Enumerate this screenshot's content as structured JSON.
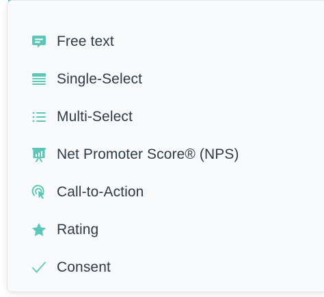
{
  "theme": {
    "accent": "#5cc6b9",
    "text": "#2e3a48",
    "panel_bg": "#f9fafb"
  },
  "menu": {
    "items": [
      {
        "label": "Free text",
        "icon": "chat-bubble-icon"
      },
      {
        "label": "Single-Select",
        "icon": "stacked-lines-icon"
      },
      {
        "label": "Multi-Select",
        "icon": "bulleted-list-icon"
      },
      {
        "label": "Net Promoter Score® (NPS)",
        "icon": "presentation-chart-icon"
      },
      {
        "label": "Call-to-Action",
        "icon": "click-pointer-icon"
      },
      {
        "label": "Rating",
        "icon": "star-icon"
      },
      {
        "label": "Consent",
        "icon": "checkmark-icon"
      }
    ]
  }
}
